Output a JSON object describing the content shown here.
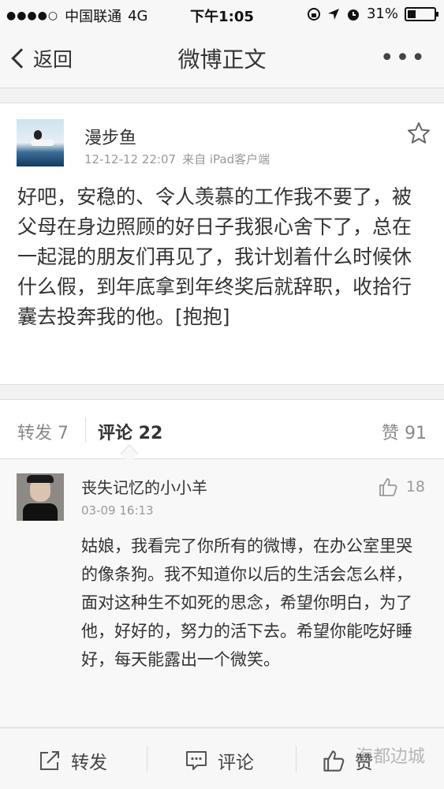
{
  "status_bar": {
    "carrier": "中国联通",
    "network": "4G",
    "time": "下午1:05",
    "battery": "31%",
    "battery_level": 0.31
  },
  "nav": {
    "back_label": "返回",
    "title": "微博正文",
    "more": "•••"
  },
  "post": {
    "author": "漫步鱼",
    "timestamp": "12-12-12 22:07",
    "source": "来自 iPad客户端",
    "text": "好吧，安稳的、令人羡慕的工作我不要了，被父母在身边照顾的好日子我狠心舍下了，总在一起混的朋友们再见了，我计划着什么时候休什么假，到年底拿到年终奖后就辞职，收拾行囊去投奔我的他。[抱抱]"
  },
  "tabs": {
    "repost": "转发 7",
    "comments": "评论 22",
    "likes": "赞 91"
  },
  "comment": {
    "author": "丧失记忆的小小羊",
    "time": "03-09 16:13",
    "likes": "18",
    "text": "姑娘，我看完了你所有的微博，在办公室里哭的像条狗。我不知道你以后的生活会怎么样，面对这种生不如死的思念，希望你明白，为了他，好好的，努力的活下去。希望你能吃好睡好，每天能露出一个微笑。"
  },
  "toolbar": {
    "repost": "转发",
    "comment": "评论",
    "like": "赞"
  },
  "watermark": "海都边城"
}
